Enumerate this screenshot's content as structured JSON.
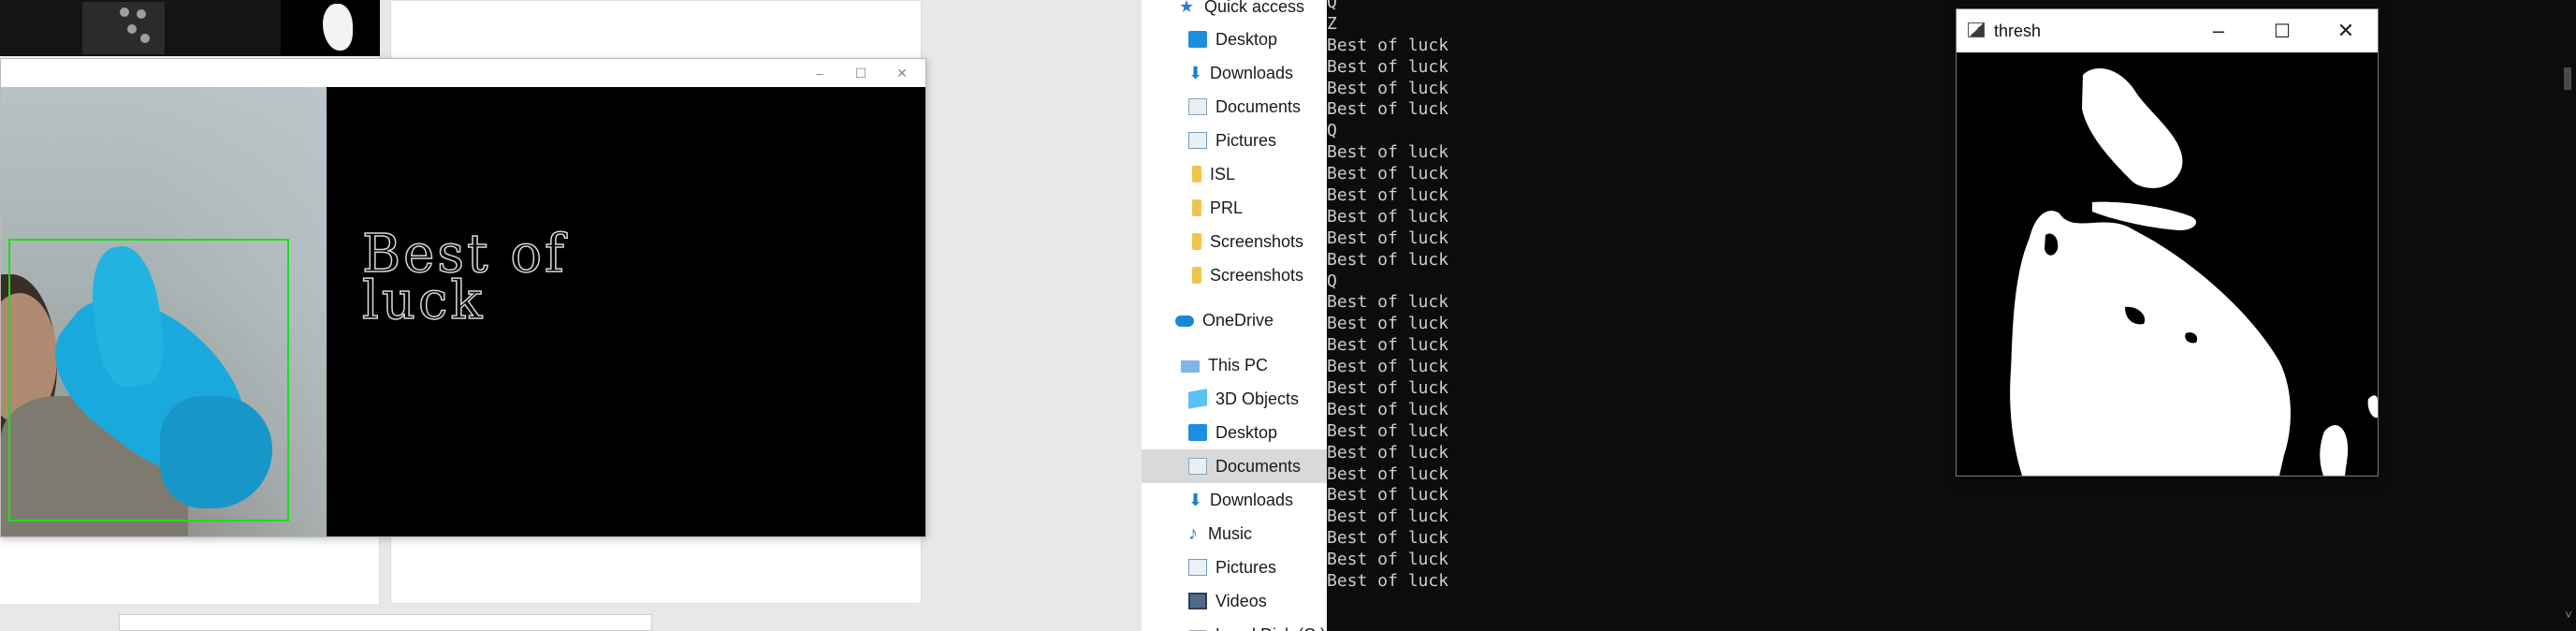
{
  "camera_window": {
    "title_controls": {
      "minimize": "–",
      "maximize": "☐",
      "close": "✕"
    },
    "prediction_text": "Best of\nluck",
    "roi_color": "#18e018"
  },
  "explorer": {
    "items": [
      {
        "label": "Quick access",
        "icon": "star-icon"
      },
      {
        "label": "Desktop",
        "icon": "desktop-icon"
      },
      {
        "label": "Downloads",
        "icon": "download-icon"
      },
      {
        "label": "Documents",
        "icon": "documents-icon"
      },
      {
        "label": "Pictures",
        "icon": "pictures-icon"
      },
      {
        "label": "ISL",
        "icon": "folder-icon"
      },
      {
        "label": "PRL",
        "icon": "folder-icon"
      },
      {
        "label": "Screenshots",
        "icon": "folder-icon"
      },
      {
        "label": "Screenshots",
        "icon": "folder-icon"
      },
      {
        "label": "OneDrive",
        "icon": "cloud-icon"
      },
      {
        "label": "This PC",
        "icon": "computer-icon"
      },
      {
        "label": "3D Objects",
        "icon": "3d-objects-icon"
      },
      {
        "label": "Desktop",
        "icon": "desktop-icon"
      },
      {
        "label": "Documents",
        "icon": "documents-icon",
        "selected": true
      },
      {
        "label": "Downloads",
        "icon": "download-icon"
      },
      {
        "label": "Music",
        "icon": "music-icon"
      },
      {
        "label": "Pictures",
        "icon": "pictures-icon"
      },
      {
        "label": "Videos",
        "icon": "videos-icon"
      },
      {
        "label": "Local Disk (C:)",
        "icon": "drive-icon"
      }
    ]
  },
  "console": {
    "lines": [
      "Q",
      "Z",
      "Best of luck",
      "Best of luck",
      "Best of luck",
      "Best of luck",
      "Q",
      "Best of luck",
      "Best of luck",
      "Best of luck",
      "Best of luck",
      "Best of luck",
      "Best of luck",
      "Q",
      "Best of luck",
      "Best of luck",
      "Best of luck",
      "Best of luck",
      "Best of luck",
      "Best of luck",
      "Best of luck",
      "Best of luck",
      "Best of luck",
      "Best of luck",
      "Best of luck",
      "Best of luck",
      "Best of luck",
      "Best of luck"
    ]
  },
  "thresh_window": {
    "title": "thresh",
    "controls": {
      "minimize": "–",
      "maximize": "☐",
      "close": "✕"
    }
  }
}
